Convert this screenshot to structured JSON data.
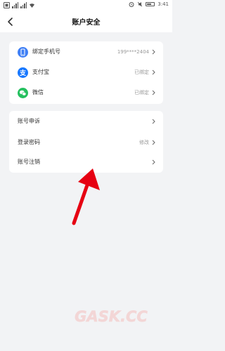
{
  "status_bar": {
    "time": "3:41",
    "battery_level": 0.5
  },
  "nav": {
    "title": "账户安全",
    "back_icon": "chevron-left-icon"
  },
  "bindings_group": {
    "items": [
      {
        "label": "绑定手机号",
        "value": "199****2404",
        "icon": "phone-icon",
        "icon_color": "#3f7ff5"
      },
      {
        "label": "支付宝",
        "value": "已绑定",
        "icon": "alipay-icon",
        "icon_color": "#1677ff"
      },
      {
        "label": "微信",
        "value": "已绑定",
        "icon": "wechat-icon",
        "icon_color": "#25c05f"
      }
    ]
  },
  "account_group": {
    "items": [
      {
        "label": "账号申诉",
        "value": ""
      },
      {
        "label": "登录密码",
        "value": "修改"
      },
      {
        "label": "账号注销",
        "value": ""
      }
    ]
  },
  "overlay": {
    "arrow_color": "#e60012"
  },
  "watermark": {
    "text": "GASK.CC"
  }
}
